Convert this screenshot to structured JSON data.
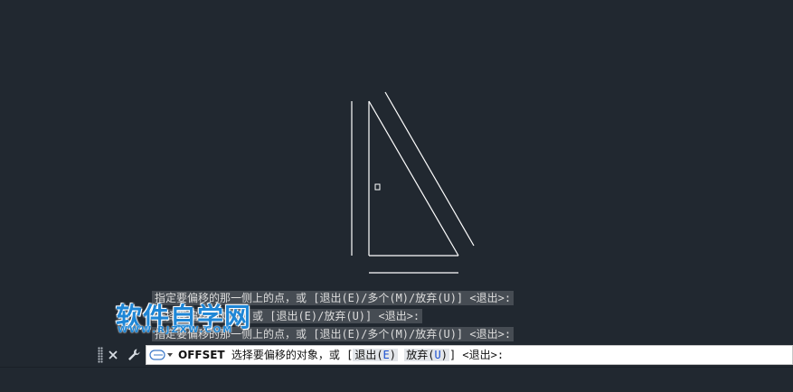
{
  "history": {
    "line1": "指定要偏移的那一侧上的点，或 [退出(E)/多个(M)/放弃(U)] <退出>:",
    "line2": "选择要偏移的对象，或 [退出(E)/放弃(U)] <退出>:",
    "line3": "指定要偏移的那一侧上的点，或 [退出(E)/多个(M)/放弃(U)] <退出>:"
  },
  "watermark": {
    "main": "软件自学网",
    "sub": "WWW.RJZXW.COM"
  },
  "command_line": {
    "close_icon": "close-icon",
    "customize_icon": "wrench-icon",
    "command_name": "OFFSET",
    "prompt_text": "选择要偏移的对象，或 [",
    "option_exit_label": "退出(",
    "option_exit_key": "E",
    "option_exit_end": ")",
    "option_undo_label": "放弃(",
    "option_undo_key": "U",
    "option_undo_end": ")",
    "prompt_suffix": "] <退出>:"
  },
  "colors": {
    "background": "#212830",
    "geometry": "#ffffff",
    "option_key": "#1a4fd0",
    "watermark": "#1e86d6"
  }
}
